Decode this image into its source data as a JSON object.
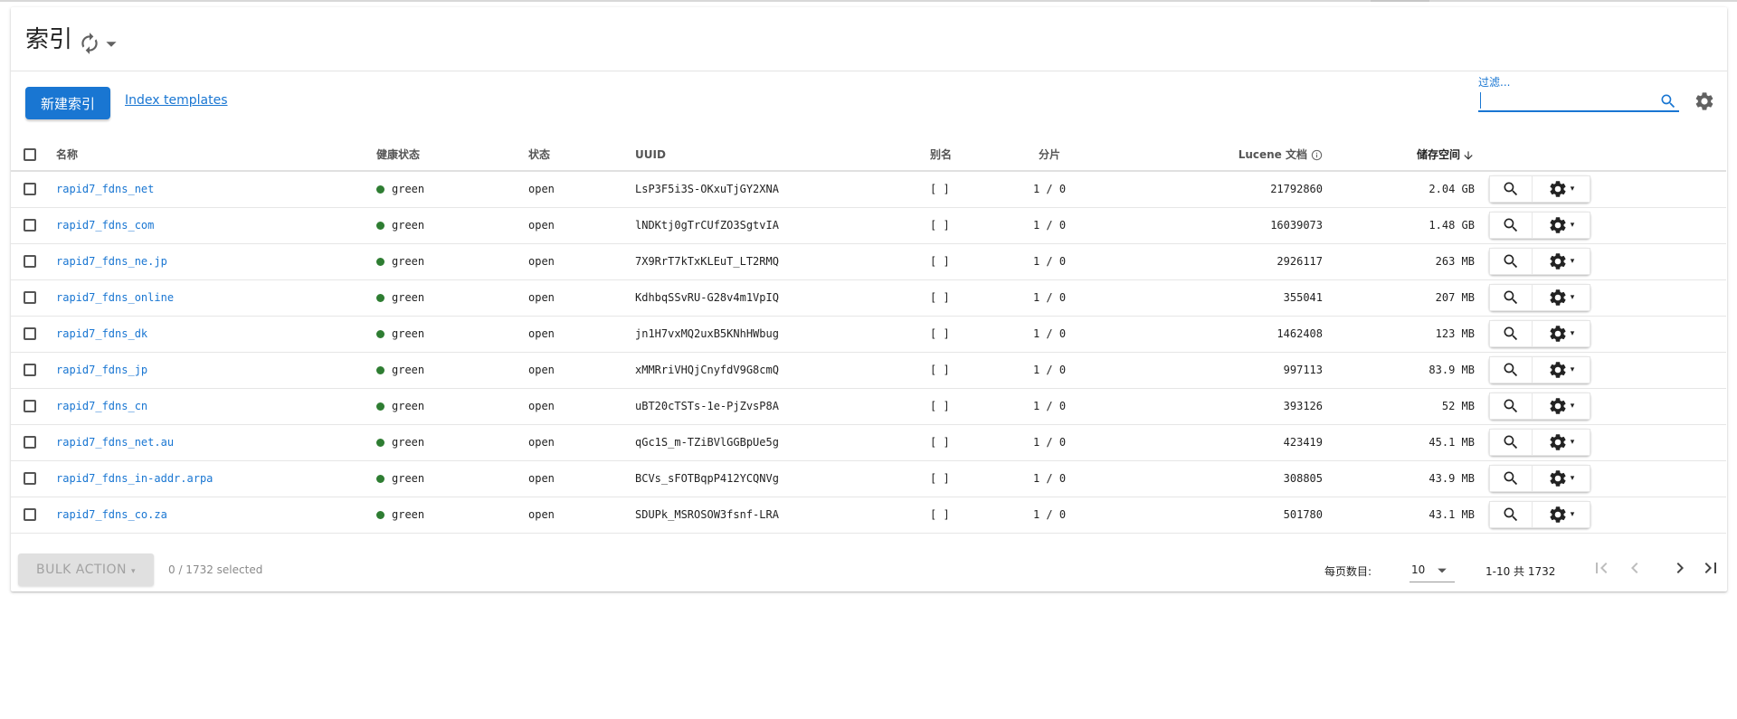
{
  "header": {
    "title": "索引"
  },
  "toolbar": {
    "new_index_label": "新建索引",
    "templates_link": "Index templates",
    "filter_label": "过滤...",
    "filter_value": ""
  },
  "table": {
    "columns": {
      "name": "名称",
      "health": "健康状态",
      "status": "状态",
      "uuid": "UUID",
      "aliases": "别名",
      "shards": "分片",
      "docs": "Lucene 文档",
      "storage": "储存空间"
    },
    "rows": [
      {
        "name": "rapid7_fdns_net",
        "health": "green",
        "status": "open",
        "uuid": "LsP3F5i3S-OKxuTjGY2XNA",
        "aliases": "[ ]",
        "shards": "1 / 0",
        "docs": "21792860",
        "storage": "2.04 GB"
      },
      {
        "name": "rapid7_fdns_com",
        "health": "green",
        "status": "open",
        "uuid": "lNDKtj0gTrCUfZO3SgtvIA",
        "aliases": "[ ]",
        "shards": "1 / 0",
        "docs": "16039073",
        "storage": "1.48 GB"
      },
      {
        "name": "rapid7_fdns_ne.jp",
        "health": "green",
        "status": "open",
        "uuid": "7X9RrT7kTxKLEuT_LT2RMQ",
        "aliases": "[ ]",
        "shards": "1 / 0",
        "docs": "2926117",
        "storage": "263 MB"
      },
      {
        "name": "rapid7_fdns_online",
        "health": "green",
        "status": "open",
        "uuid": "KdhbqSSvRU-G28v4m1VpIQ",
        "aliases": "[ ]",
        "shards": "1 / 0",
        "docs": "355041",
        "storage": "207 MB"
      },
      {
        "name": "rapid7_fdns_dk",
        "health": "green",
        "status": "open",
        "uuid": "jn1H7vxMQ2uxB5KNhHWbug",
        "aliases": "[ ]",
        "shards": "1 / 0",
        "docs": "1462408",
        "storage": "123 MB"
      },
      {
        "name": "rapid7_fdns_jp",
        "health": "green",
        "status": "open",
        "uuid": "xMMRriVHQjCnyfdV9G8cmQ",
        "aliases": "[ ]",
        "shards": "1 / 0",
        "docs": "997113",
        "storage": "83.9 MB"
      },
      {
        "name": "rapid7_fdns_cn",
        "health": "green",
        "status": "open",
        "uuid": "uBT20cTSTs-1e-PjZvsP8A",
        "aliases": "[ ]",
        "shards": "1 / 0",
        "docs": "393126",
        "storage": "52 MB"
      },
      {
        "name": "rapid7_fdns_net.au",
        "health": "green",
        "status": "open",
        "uuid": "qGc1S_m-TZiBVlGGBpUe5g",
        "aliases": "[ ]",
        "shards": "1 / 0",
        "docs": "423419",
        "storage": "45.1 MB"
      },
      {
        "name": "rapid7_fdns_in-addr.arpa",
        "health": "green",
        "status": "open",
        "uuid": "BCVs_sFOTBqpP412YCQNVg",
        "aliases": "[ ]",
        "shards": "1 / 0",
        "docs": "308805",
        "storage": "43.9 MB"
      },
      {
        "name": "rapid7_fdns_co.za",
        "health": "green",
        "status": "open",
        "uuid": "SDUPk_MSROSOW3fsnf-LRA",
        "aliases": "[ ]",
        "shards": "1 / 0",
        "docs": "501780",
        "storage": "43.1 MB"
      }
    ]
  },
  "footer": {
    "bulk_action_label": "BULK ACTION",
    "selected_text": "0 / 1732 selected",
    "per_page_label": "每页数目:",
    "per_page_value": "10",
    "range_text": "1-10 共 1732"
  },
  "colors": {
    "accent": "#1976d2",
    "health_green": "#2e7d32"
  },
  "icons": [
    "refresh-icon",
    "chevron-down-icon",
    "search-icon",
    "gear-icon",
    "info-icon",
    "sort-arrow-down-icon",
    "first-page-icon",
    "previous-page-icon",
    "next-page-icon",
    "last-page-icon"
  ]
}
